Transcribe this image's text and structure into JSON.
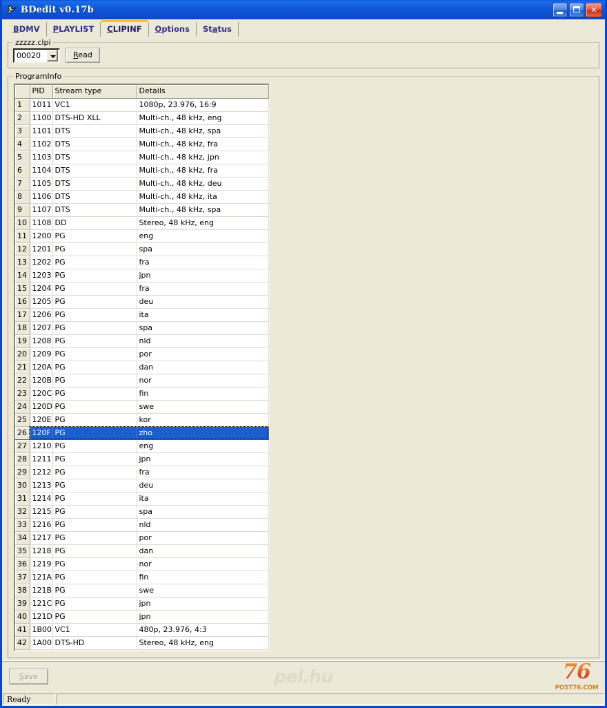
{
  "window": {
    "title": "BDedit v0.17b",
    "icon": "app-bird-icon",
    "minimize_label": "Minimize",
    "maximize_label": "Maximize",
    "close_label": "Close",
    "accent_title_color": "#0a46c8",
    "face_color": "#ece9d8"
  },
  "tabs": [
    {
      "label": "BDMV",
      "accel": "B",
      "active": false
    },
    {
      "label": "PLAYLIST",
      "accel": "P",
      "active": false
    },
    {
      "label": "CLIPINF",
      "accel": "C",
      "active": true
    },
    {
      "label": "Options",
      "accel": "O",
      "active": false
    },
    {
      "label": "Status",
      "accel": "a",
      "active": false
    }
  ],
  "tab_active_underline_color": "#ffbc21",
  "file_group": {
    "title": "zzzzz.clpi",
    "combo_value": "00020",
    "combo_name": "clip-select",
    "read_label": "Read",
    "read_accel": "R"
  },
  "program_info": {
    "title": "ProgramInfo",
    "columns": [
      "",
      "PID",
      "Stream type",
      "Details"
    ],
    "selected_index": 26,
    "selection_color": "#1b5fce",
    "rows": [
      {
        "n": "1",
        "pid": "1011",
        "type": "VC1",
        "details": "1080p, 23.976, 16:9"
      },
      {
        "n": "2",
        "pid": "1100",
        "type": "DTS-HD XLL",
        "details": "Multi-ch., 48 kHz, eng"
      },
      {
        "n": "3",
        "pid": "1101",
        "type": "DTS",
        "details": "Multi-ch., 48 kHz, spa"
      },
      {
        "n": "4",
        "pid": "1102",
        "type": "DTS",
        "details": "Multi-ch., 48 kHz, fra"
      },
      {
        "n": "5",
        "pid": "1103",
        "type": "DTS",
        "details": "Multi-ch., 48 kHz, jpn"
      },
      {
        "n": "6",
        "pid": "1104",
        "type": "DTS",
        "details": "Multi-ch., 48 kHz, fra"
      },
      {
        "n": "7",
        "pid": "1105",
        "type": "DTS",
        "details": "Multi-ch., 48 kHz, deu"
      },
      {
        "n": "8",
        "pid": "1106",
        "type": "DTS",
        "details": "Multi-ch., 48 kHz, ita"
      },
      {
        "n": "9",
        "pid": "1107",
        "type": "DTS",
        "details": "Multi-ch., 48 kHz, spa"
      },
      {
        "n": "10",
        "pid": "1108",
        "type": "DD",
        "details": "Stereo, 48 kHz, eng"
      },
      {
        "n": "11",
        "pid": "1200",
        "type": "PG",
        "details": "eng"
      },
      {
        "n": "12",
        "pid": "1201",
        "type": "PG",
        "details": "spa"
      },
      {
        "n": "13",
        "pid": "1202",
        "type": "PG",
        "details": "fra"
      },
      {
        "n": "14",
        "pid": "1203",
        "type": "PG",
        "details": "jpn"
      },
      {
        "n": "15",
        "pid": "1204",
        "type": "PG",
        "details": "fra"
      },
      {
        "n": "16",
        "pid": "1205",
        "type": "PG",
        "details": "deu"
      },
      {
        "n": "17",
        "pid": "1206",
        "type": "PG",
        "details": "ita"
      },
      {
        "n": "18",
        "pid": "1207",
        "type": "PG",
        "details": "spa"
      },
      {
        "n": "19",
        "pid": "1208",
        "type": "PG",
        "details": "nld"
      },
      {
        "n": "20",
        "pid": "1209",
        "type": "PG",
        "details": "por"
      },
      {
        "n": "21",
        "pid": "120A",
        "type": "PG",
        "details": "dan"
      },
      {
        "n": "22",
        "pid": "120B",
        "type": "PG",
        "details": "nor"
      },
      {
        "n": "23",
        "pid": "120C",
        "type": "PG",
        "details": "fin"
      },
      {
        "n": "24",
        "pid": "120D",
        "type": "PG",
        "details": "swe"
      },
      {
        "n": "25",
        "pid": "120E",
        "type": "PG",
        "details": "kor"
      },
      {
        "n": "26",
        "pid": "120F",
        "type": "PG",
        "details": "zho"
      },
      {
        "n": "27",
        "pid": "1210",
        "type": "PG",
        "details": "eng"
      },
      {
        "n": "28",
        "pid": "1211",
        "type": "PG",
        "details": "jpn"
      },
      {
        "n": "29",
        "pid": "1212",
        "type": "PG",
        "details": "fra"
      },
      {
        "n": "30",
        "pid": "1213",
        "type": "PG",
        "details": "deu"
      },
      {
        "n": "31",
        "pid": "1214",
        "type": "PG",
        "details": "ita"
      },
      {
        "n": "32",
        "pid": "1215",
        "type": "PG",
        "details": "spa"
      },
      {
        "n": "33",
        "pid": "1216",
        "type": "PG",
        "details": "nld"
      },
      {
        "n": "34",
        "pid": "1217",
        "type": "PG",
        "details": "por"
      },
      {
        "n": "35",
        "pid": "1218",
        "type": "PG",
        "details": "dan"
      },
      {
        "n": "36",
        "pid": "1219",
        "type": "PG",
        "details": "nor"
      },
      {
        "n": "37",
        "pid": "121A",
        "type": "PG",
        "details": "fin"
      },
      {
        "n": "38",
        "pid": "121B",
        "type": "PG",
        "details": "swe"
      },
      {
        "n": "39",
        "pid": "121C",
        "type": "PG",
        "details": "jpn"
      },
      {
        "n": "40",
        "pid": "121D",
        "type": "PG",
        "details": "jpn"
      },
      {
        "n": "41",
        "pid": "1B00",
        "type": "VC1",
        "details": "480p, 23.976, 4:3"
      },
      {
        "n": "42",
        "pid": "1A00",
        "type": "DTS-HD",
        "details": "Stereo, 48 kHz, eng"
      }
    ]
  },
  "footer": {
    "save_label": "Save",
    "save_accel": "S",
    "save_disabled": true,
    "watermark": "pel.hu",
    "logo_number": "76",
    "logo_domain": "POST76.COM"
  },
  "statusbar": {
    "message": "Ready"
  }
}
